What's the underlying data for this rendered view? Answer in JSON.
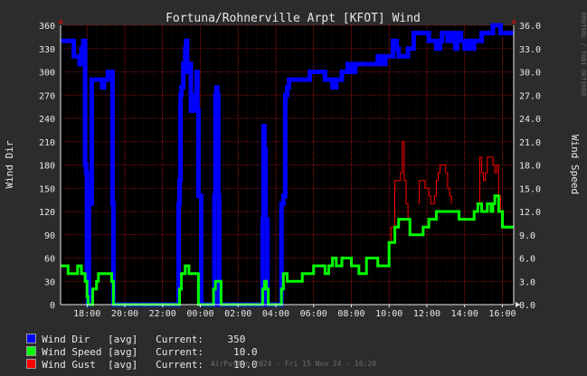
{
  "chart_data": {
    "type": "line",
    "title": "Fortuna/Rohnerville Arpt [KFOT] Wind",
    "ylabel_left": "Wind Dir",
    "ylabel_right": "Wind Speed",
    "watermark": "RRDTOOL / TOBI OETIKER",
    "x_tick_labels": [
      "18:00",
      "20:00",
      "22:00",
      "00:00",
      "02:00",
      "04:00",
      "06:00",
      "08:00",
      "10:00",
      "12:00",
      "14:00",
      "16:00"
    ],
    "x_ticks_hours": [
      18,
      20,
      22,
      24,
      26,
      28,
      30,
      32,
      34,
      36,
      38,
      40
    ],
    "xlim_hours": [
      16.6,
      40.6
    ],
    "y_left_ticks": [
      0,
      30,
      60,
      90,
      120,
      150,
      180,
      210,
      240,
      270,
      300,
      330,
      360
    ],
    "y_right_ticks": [
      "0.0",
      "3.0",
      "6.0",
      "9.0",
      "12.0",
      "15.0",
      "18.0",
      "21.0",
      "24.0",
      "27.0",
      "30.0",
      "33.0",
      "36.0"
    ],
    "ylim_left": [
      0,
      360
    ],
    "ylim_right": [
      0,
      36
    ],
    "series": [
      {
        "name": "Wind Dir",
        "axis": "left",
        "color": "#0000ff",
        "points": [
          [
            16.6,
            340
          ],
          [
            17.2,
            340
          ],
          [
            17.3,
            320
          ],
          [
            17.6,
            310
          ],
          [
            17.7,
            330
          ],
          [
            17.75,
            320
          ],
          [
            17.8,
            340
          ],
          [
            17.85,
            340
          ],
          [
            17.9,
            180
          ],
          [
            17.95,
            170
          ],
          [
            18.0,
            40
          ],
          [
            18.05,
            0
          ],
          [
            18.1,
            140
          ],
          [
            18.15,
            150
          ],
          [
            18.2,
            130
          ],
          [
            18.25,
            290
          ],
          [
            18.3,
            290
          ],
          [
            18.5,
            290
          ],
          [
            18.6,
            290
          ],
          [
            18.7,
            290
          ],
          [
            18.8,
            280
          ],
          [
            18.9,
            290
          ],
          [
            19.0,
            290
          ],
          [
            19.1,
            300
          ],
          [
            19.3,
            300
          ],
          [
            19.35,
            130
          ],
          [
            19.4,
            0
          ],
          [
            22.8,
            0
          ],
          [
            22.85,
            130
          ],
          [
            22.9,
            160
          ],
          [
            22.95,
            270
          ],
          [
            23.0,
            280
          ],
          [
            23.1,
            310
          ],
          [
            23.2,
            330
          ],
          [
            23.25,
            340
          ],
          [
            23.3,
            300
          ],
          [
            23.4,
            310
          ],
          [
            23.5,
            250
          ],
          [
            23.6,
            270
          ],
          [
            23.7,
            250
          ],
          [
            23.8,
            300
          ],
          [
            23.85,
            250
          ],
          [
            23.9,
            140
          ],
          [
            24.0,
            140
          ],
          [
            24.05,
            0
          ],
          [
            24.7,
            0
          ],
          [
            24.75,
            140
          ],
          [
            24.8,
            270
          ],
          [
            24.85,
            280
          ],
          [
            24.9,
            270
          ],
          [
            24.95,
            140
          ],
          [
            25.0,
            0
          ],
          [
            27.2,
            0
          ],
          [
            27.25,
            0
          ],
          [
            27.3,
            110
          ],
          [
            27.35,
            230
          ],
          [
            27.4,
            200
          ],
          [
            27.45,
            110
          ],
          [
            27.5,
            110
          ],
          [
            27.55,
            0
          ],
          [
            28.2,
            0
          ],
          [
            28.25,
            0
          ],
          [
            28.3,
            130
          ],
          [
            28.4,
            140
          ],
          [
            28.5,
            270
          ],
          [
            28.6,
            280
          ],
          [
            28.7,
            290
          ],
          [
            29.0,
            290
          ],
          [
            29.3,
            290
          ],
          [
            29.6,
            290
          ],
          [
            29.7,
            290
          ],
          [
            29.8,
            300
          ],
          [
            30.2,
            300
          ],
          [
            30.6,
            290
          ],
          [
            30.8,
            290
          ],
          [
            31.0,
            280
          ],
          [
            31.2,
            290
          ],
          [
            31.5,
            300
          ],
          [
            31.7,
            300
          ],
          [
            31.8,
            310
          ],
          [
            32.0,
            300
          ],
          [
            32.2,
            310
          ],
          [
            32.5,
            310
          ],
          [
            32.8,
            310
          ],
          [
            33.0,
            310
          ],
          [
            33.2,
            310
          ],
          [
            33.4,
            320
          ],
          [
            33.6,
            310
          ],
          [
            33.8,
            320
          ],
          [
            34.0,
            320
          ],
          [
            34.2,
            340
          ],
          [
            34.4,
            330
          ],
          [
            34.5,
            320
          ],
          [
            34.8,
            320
          ],
          [
            35.0,
            330
          ],
          [
            35.2,
            330
          ],
          [
            35.3,
            350
          ],
          [
            35.6,
            350
          ],
          [
            35.8,
            350
          ],
          [
            36.0,
            350
          ],
          [
            36.1,
            340
          ],
          [
            36.3,
            340
          ],
          [
            36.5,
            330
          ],
          [
            36.7,
            340
          ],
          [
            36.8,
            350
          ],
          [
            37.0,
            350
          ],
          [
            37.1,
            340
          ],
          [
            37.3,
            350
          ],
          [
            37.5,
            330
          ],
          [
            37.6,
            340
          ],
          [
            37.7,
            350
          ],
          [
            37.8,
            340
          ],
          [
            38.0,
            330
          ],
          [
            38.1,
            340
          ],
          [
            38.3,
            330
          ],
          [
            38.5,
            340
          ],
          [
            38.7,
            340
          ],
          [
            38.9,
            350
          ],
          [
            39.1,
            350
          ],
          [
            39.3,
            350
          ],
          [
            39.5,
            360
          ],
          [
            39.7,
            360
          ],
          [
            39.9,
            350
          ],
          [
            40.6,
            350
          ]
        ]
      },
      {
        "name": "Wind Speed",
        "axis": "right",
        "color": "#00ff00",
        "points": [
          [
            16.6,
            5
          ],
          [
            16.9,
            5
          ],
          [
            17.0,
            4
          ],
          [
            17.3,
            4
          ],
          [
            17.5,
            5
          ],
          [
            17.7,
            4
          ],
          [
            17.8,
            4
          ],
          [
            17.9,
            3
          ],
          [
            18.0,
            1
          ],
          [
            18.05,
            0
          ],
          [
            18.2,
            0
          ],
          [
            18.3,
            2
          ],
          [
            18.5,
            3
          ],
          [
            18.6,
            4
          ],
          [
            19.2,
            4
          ],
          [
            19.3,
            3
          ],
          [
            19.4,
            0
          ],
          [
            22.8,
            0
          ],
          [
            22.9,
            2
          ],
          [
            23.0,
            4
          ],
          [
            23.2,
            5
          ],
          [
            23.4,
            4
          ],
          [
            23.6,
            4
          ],
          [
            23.8,
            4
          ],
          [
            23.9,
            0
          ],
          [
            24.6,
            0
          ],
          [
            24.7,
            2
          ],
          [
            24.8,
            3
          ],
          [
            25.0,
            3
          ],
          [
            25.1,
            0
          ],
          [
            27.2,
            0
          ],
          [
            27.3,
            2
          ],
          [
            27.4,
            3
          ],
          [
            27.5,
            2
          ],
          [
            27.6,
            0
          ],
          [
            28.2,
            0
          ],
          [
            28.3,
            2
          ],
          [
            28.4,
            4
          ],
          [
            28.6,
            3
          ],
          [
            29.2,
            3
          ],
          [
            29.4,
            4
          ],
          [
            29.8,
            4
          ],
          [
            30.0,
            5
          ],
          [
            30.4,
            5
          ],
          [
            30.6,
            4
          ],
          [
            30.8,
            5
          ],
          [
            31.0,
            6
          ],
          [
            31.2,
            5
          ],
          [
            31.5,
            6
          ],
          [
            31.8,
            6
          ],
          [
            32.0,
            5
          ],
          [
            32.2,
            5
          ],
          [
            32.4,
            4
          ],
          [
            32.6,
            4
          ],
          [
            32.8,
            6
          ],
          [
            33.2,
            6
          ],
          [
            33.4,
            5
          ],
          [
            33.6,
            5
          ],
          [
            33.8,
            5
          ],
          [
            34.0,
            8
          ],
          [
            34.2,
            8
          ],
          [
            34.3,
            10
          ],
          [
            34.5,
            11
          ],
          [
            35.0,
            11
          ],
          [
            35.1,
            9
          ],
          [
            35.7,
            9
          ],
          [
            35.8,
            10
          ],
          [
            36.1,
            11
          ],
          [
            36.3,
            11
          ],
          [
            36.5,
            12
          ],
          [
            36.8,
            12
          ],
          [
            37.2,
            12
          ],
          [
            37.5,
            12
          ],
          [
            37.7,
            11
          ],
          [
            38.0,
            11
          ],
          [
            38.3,
            11
          ],
          [
            38.5,
            12
          ],
          [
            38.7,
            13
          ],
          [
            38.9,
            12
          ],
          [
            39.1,
            12
          ],
          [
            39.2,
            13
          ],
          [
            39.4,
            12
          ],
          [
            39.5,
            13
          ],
          [
            39.6,
            14
          ],
          [
            39.8,
            12
          ],
          [
            39.9,
            12
          ],
          [
            40.0,
            10
          ],
          [
            40.6,
            10
          ]
        ]
      },
      {
        "name": "Wind Gust",
        "axis": "right",
        "color": "#ff0000",
        "points": [
          [
            33.85,
            null
          ],
          [
            33.9,
            8
          ],
          [
            34.0,
            8
          ],
          [
            34.1,
            10
          ],
          [
            34.2,
            10
          ],
          [
            34.3,
            16
          ],
          [
            34.5,
            16
          ],
          [
            34.6,
            17
          ],
          [
            34.7,
            21
          ],
          [
            34.8,
            16
          ],
          [
            34.9,
            13
          ],
          [
            35.0,
            11
          ],
          [
            35.05,
            11
          ],
          [
            35.1,
            null
          ],
          [
            35.5,
            null
          ],
          [
            35.55,
            13
          ],
          [
            35.6,
            16
          ],
          [
            35.8,
            16
          ],
          [
            35.9,
            15
          ],
          [
            36.0,
            15
          ],
          [
            36.1,
            14
          ],
          [
            36.2,
            13
          ],
          [
            36.3,
            13
          ],
          [
            36.4,
            14
          ],
          [
            36.5,
            16
          ],
          [
            36.6,
            17
          ],
          [
            36.7,
            18
          ],
          [
            36.9,
            18
          ],
          [
            37.0,
            17
          ],
          [
            37.1,
            15
          ],
          [
            37.2,
            14
          ],
          [
            37.3,
            13
          ],
          [
            37.4,
            null
          ],
          [
            38.5,
            null
          ],
          [
            38.6,
            13
          ],
          [
            38.8,
            19
          ],
          [
            38.9,
            17
          ],
          [
            39.0,
            16
          ],
          [
            39.1,
            17
          ],
          [
            39.2,
            19
          ],
          [
            39.4,
            19
          ],
          [
            39.5,
            18
          ],
          [
            39.6,
            17
          ],
          [
            39.7,
            18
          ],
          [
            39.8,
            14
          ],
          [
            39.9,
            12
          ],
          [
            40.0,
            10
          ],
          [
            40.6,
            10
          ]
        ]
      }
    ],
    "legend": {
      "placement": "bottom-left",
      "rows": [
        {
          "label": "Wind Dir   [avg]   Current:    350",
          "color": "#0000ff"
        },
        {
          "label": "Wind Speed [avg]   Current:     10.0",
          "color": "#00ff00"
        },
        {
          "label": "Wind Gust  [avg]   Current:     10.0",
          "color": "#ff0000"
        }
      ]
    },
    "footer": "AirPuffin 2024 - Fri 15 Nov 24 - 16:20",
    "grid": true,
    "colors": {
      "background": "#2c2c2c",
      "plot_background": "#000000",
      "grid": "#8b0000",
      "text": "#e8e8e8"
    }
  }
}
